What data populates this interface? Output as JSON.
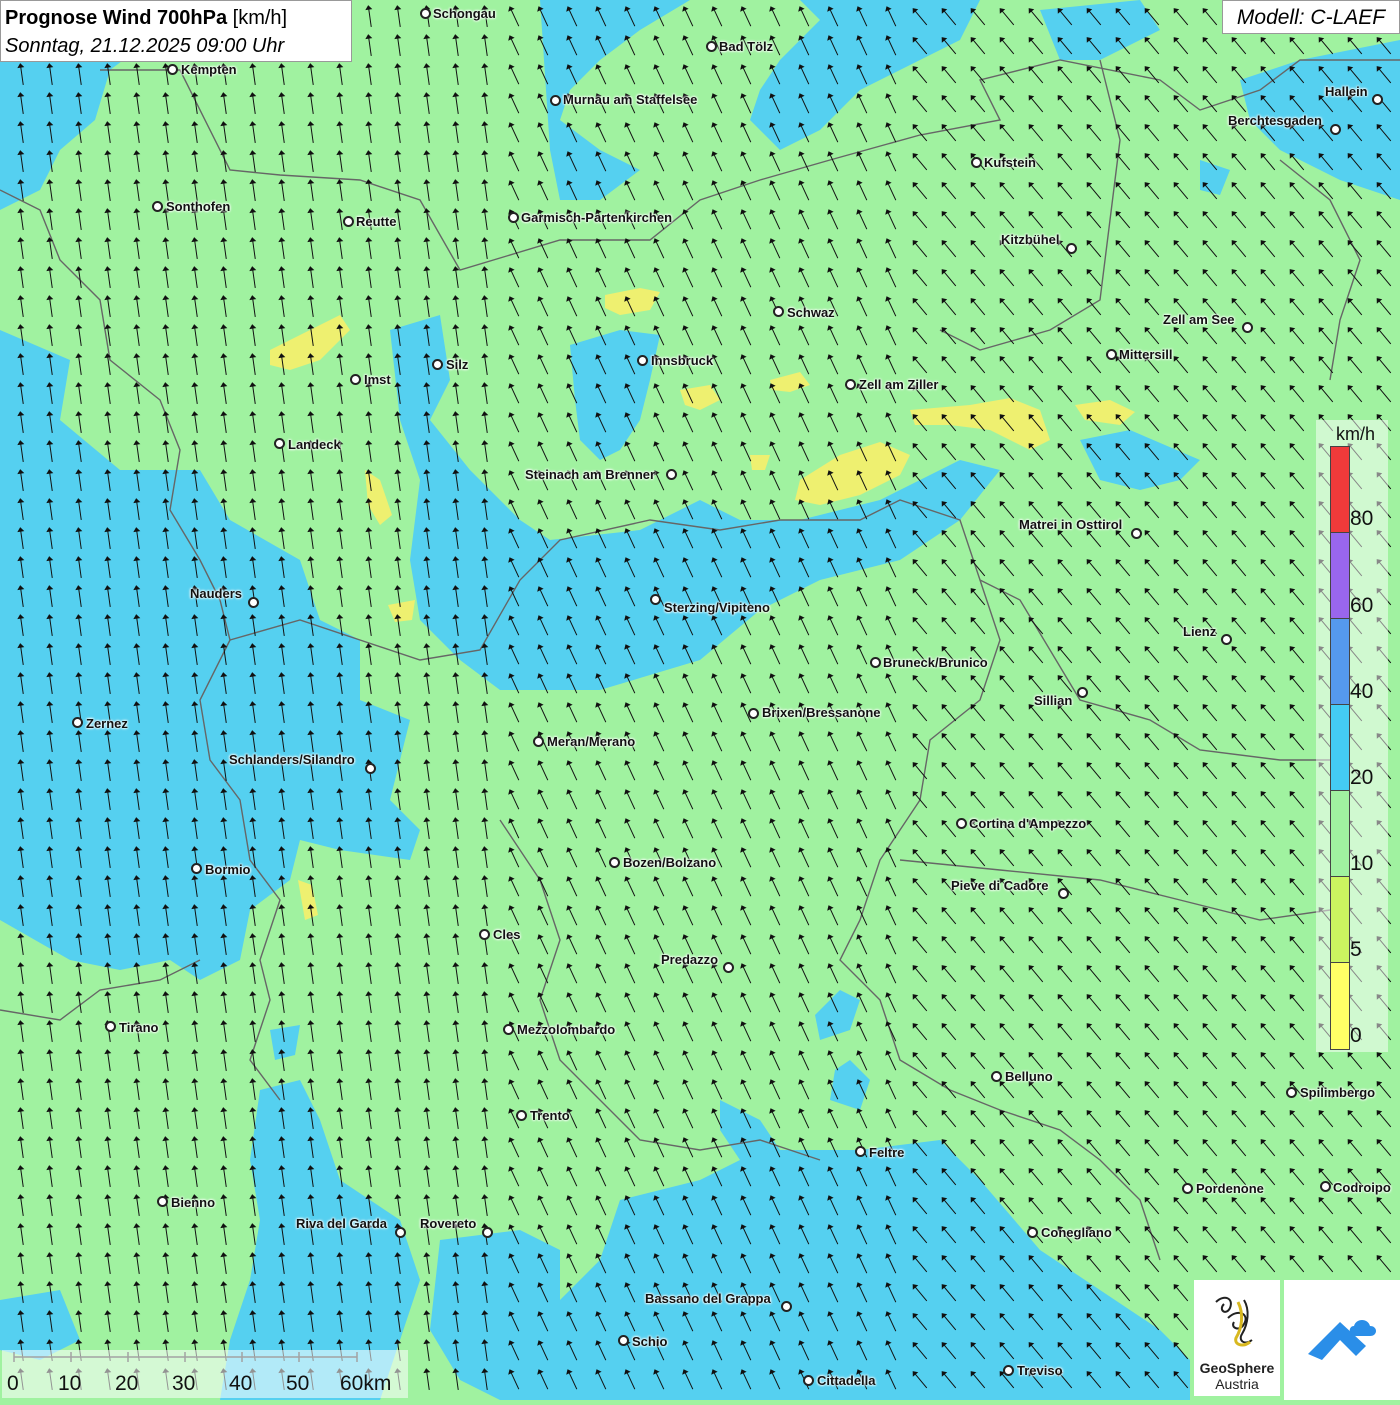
{
  "title": {
    "main": "Prognose Wind 700hPa",
    "unit": "[km/h]",
    "datetime": "Sonntag, 21.12.2025 09:00 Uhr"
  },
  "model_label": "Modell: C-LAEF",
  "cities": [
    "Schongau",
    "Bad Tölz",
    "Kempten",
    "Murnau am Staffelsee",
    "Hallein",
    "Berchtesgaden",
    "Kufstein",
    "Sonthofen",
    "Reutte",
    "Garmisch-Partenkirchen",
    "Kitzbühel",
    "Schwaz",
    "Zell am See",
    "Innsbruck",
    "Silz",
    "Mittersill",
    "Imst",
    "Zell am Ziller",
    "Landeck",
    "Steinach am Brenner",
    "Matrei in Osttirol",
    "Nauders",
    "Sterzing/Vipiteno",
    "Lienz",
    "Bruneck/Brunico",
    "Sillian",
    "Zernez",
    "Brixen/Bressanone",
    "Meran/Merano",
    "Schlanders/Silandro",
    "Cortina d'Ampezzo",
    "Bozen/Bolzano",
    "Bormio",
    "Pieve di Cadore",
    "Cles",
    "Predazzo",
    "Tirano",
    "Mezzolombardo",
    "Belluno",
    "Spilimbergo",
    "Trento",
    "Feltre",
    "Pordenone",
    "Codroipo",
    "Bienno",
    "Riva del Garda",
    "Rovereto",
    "Conegliano",
    "Bassano del Grappa",
    "Schio",
    "Treviso",
    "Cittadella"
  ],
  "legend": {
    "unit": "km/h",
    "steps": [
      {
        "label": "80",
        "color": "#f03a3a"
      },
      {
        "label": "60",
        "color": "#9966ee"
      },
      {
        "label": "40",
        "color": "#5599ee"
      },
      {
        "label": "20",
        "color": "#44ccf4"
      },
      {
        "label": "10",
        "color": "#a0f2a0"
      },
      {
        "label": "5",
        "color": "#ccf560"
      },
      {
        "label": "0",
        "color": "#ffff66"
      }
    ]
  },
  "scale_bar": {
    "labels": [
      "0",
      "10",
      "20",
      "30",
      "40",
      "50",
      "60km"
    ]
  },
  "logos": {
    "geosphere_line1": "GeoSphere",
    "geosphere_line2": "Austria"
  },
  "colors": {
    "light_wind": "#a0f2a0",
    "moderate_wind": "#55d0f0",
    "calm": "#eeee70"
  }
}
